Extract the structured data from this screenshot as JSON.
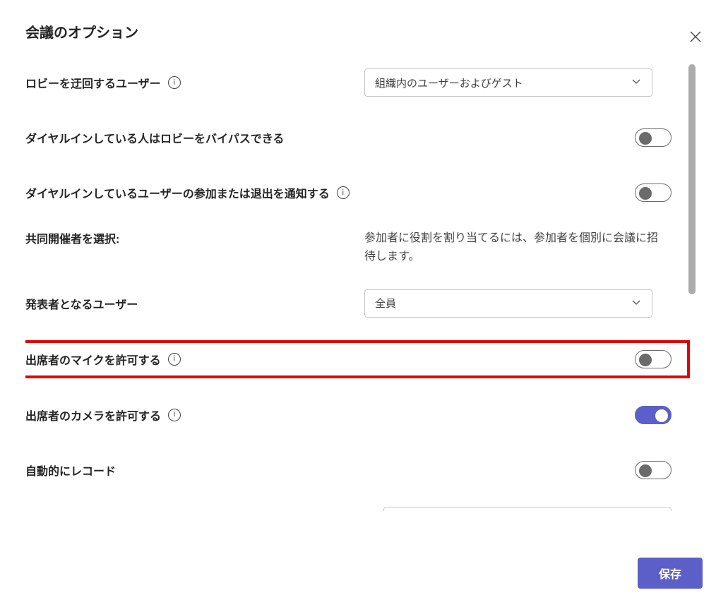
{
  "title": "会議のオプション",
  "rows": {
    "lobby_bypass": {
      "label": "ロビーを迂回するユーザー",
      "select_value": "組織内のユーザーおよびゲスト"
    },
    "dialin_bypass": {
      "label": "ダイヤルインしている人はロビーをバイパスできる"
    },
    "dialin_notify": {
      "label": "ダイヤルインしているユーザーの参加または退出を通知する"
    },
    "coorganizer": {
      "label": "共同開催者を選択:",
      "helper": "参加者に役割を割り当てるには、参加者を個別に会議に招待します。"
    },
    "presenter": {
      "label": "発表者となるユーザー",
      "select_value": "全員"
    },
    "allow_mic": {
      "label": "出席者のマイクを許可する"
    },
    "allow_camera": {
      "label": "出席者のカメラを許可する"
    },
    "auto_record": {
      "label": "自動的にレコード"
    }
  },
  "footer": {
    "save": "保存"
  }
}
